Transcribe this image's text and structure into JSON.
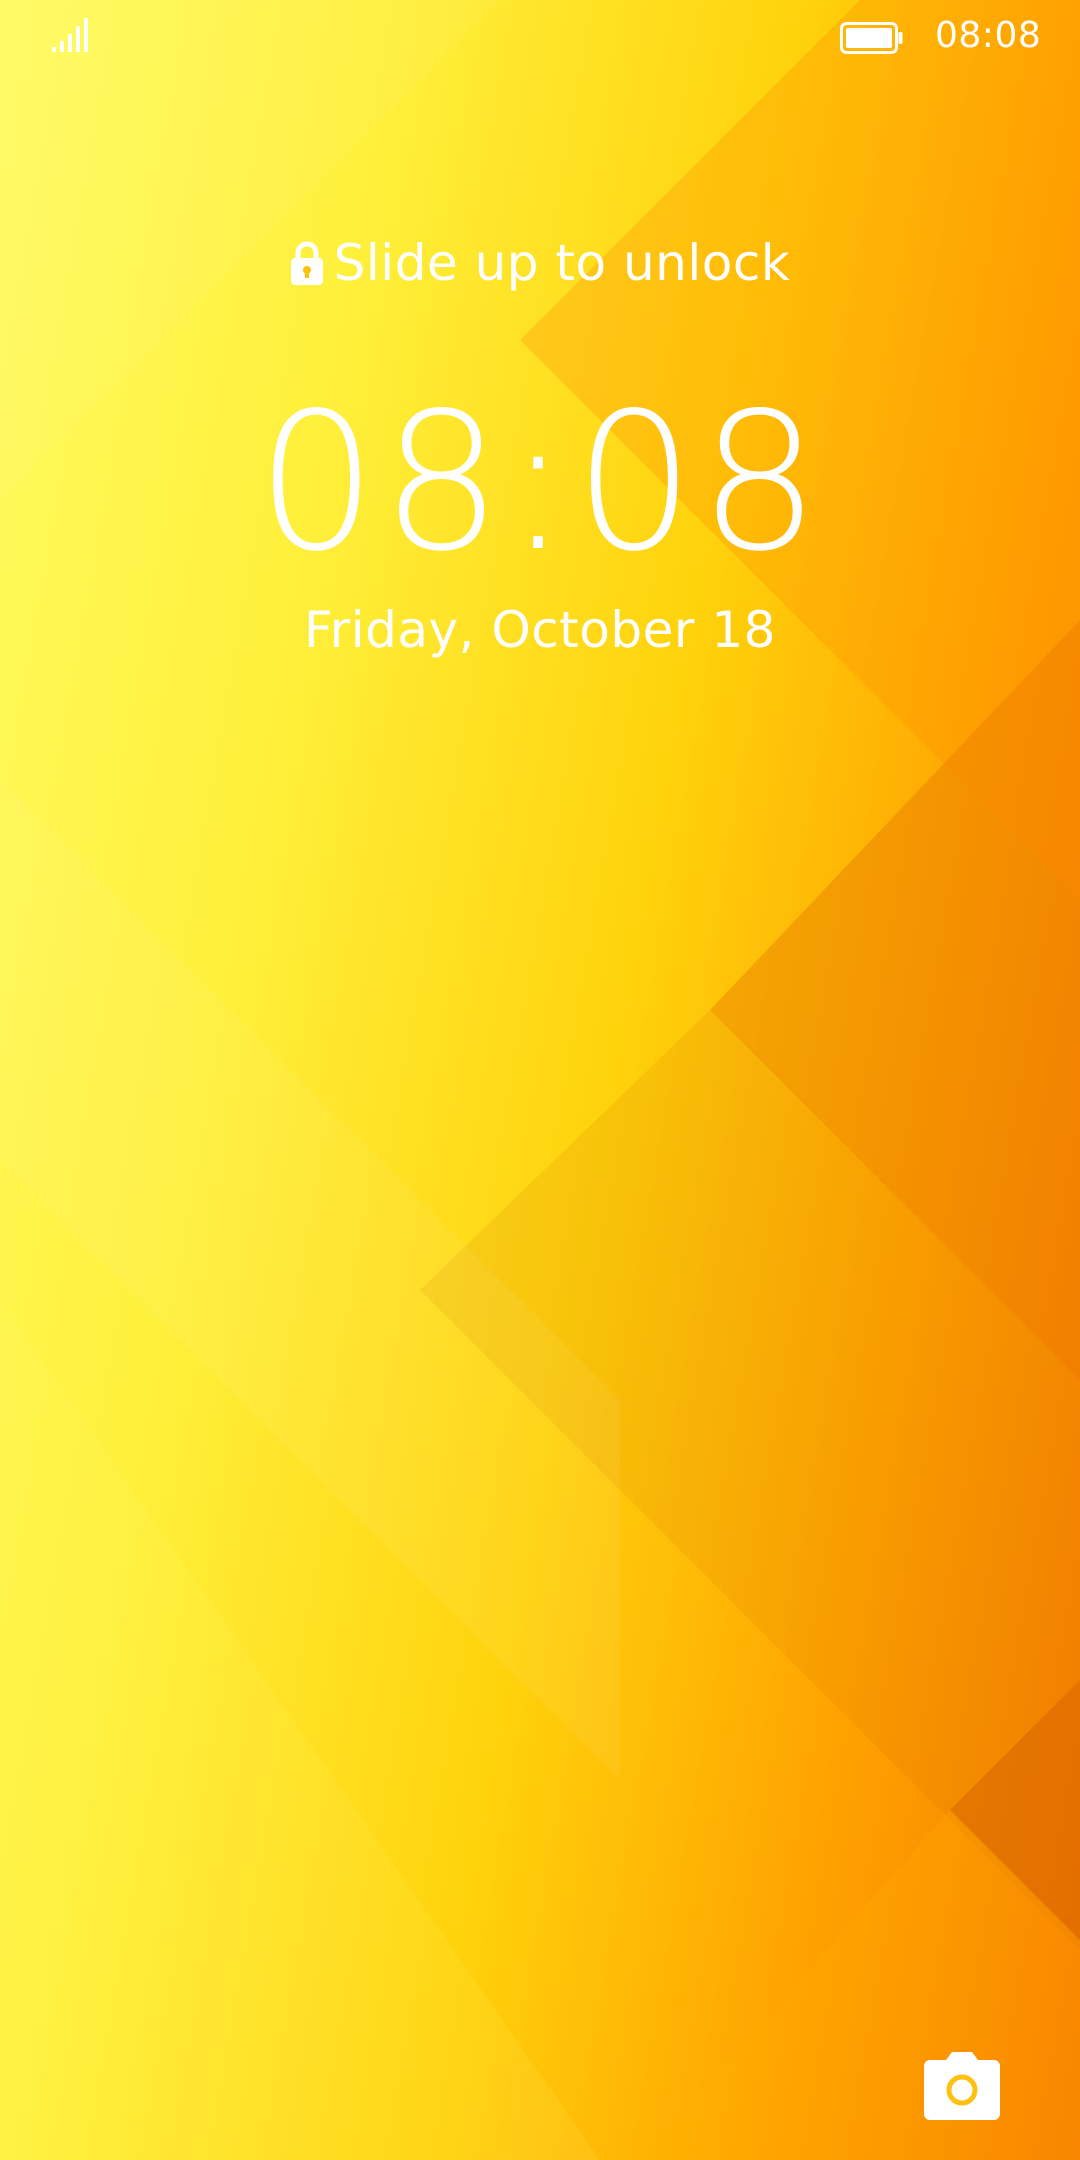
{
  "status_bar": {
    "signal_icon": "signal-bars-icon",
    "battery_icon": "battery-full-icon",
    "time": "08:08"
  },
  "lock_screen": {
    "lock_icon": "lock-icon",
    "unlock_hint": "Slide up to unlock",
    "clock": "08:08",
    "date": "Friday, October 18",
    "camera_icon": "camera-icon"
  },
  "colors": {
    "wallpaper_light": "#fffb60",
    "wallpaper_mid": "#ffd20c",
    "wallpaper_dark": "#f77a00",
    "text": "#ffffff"
  }
}
